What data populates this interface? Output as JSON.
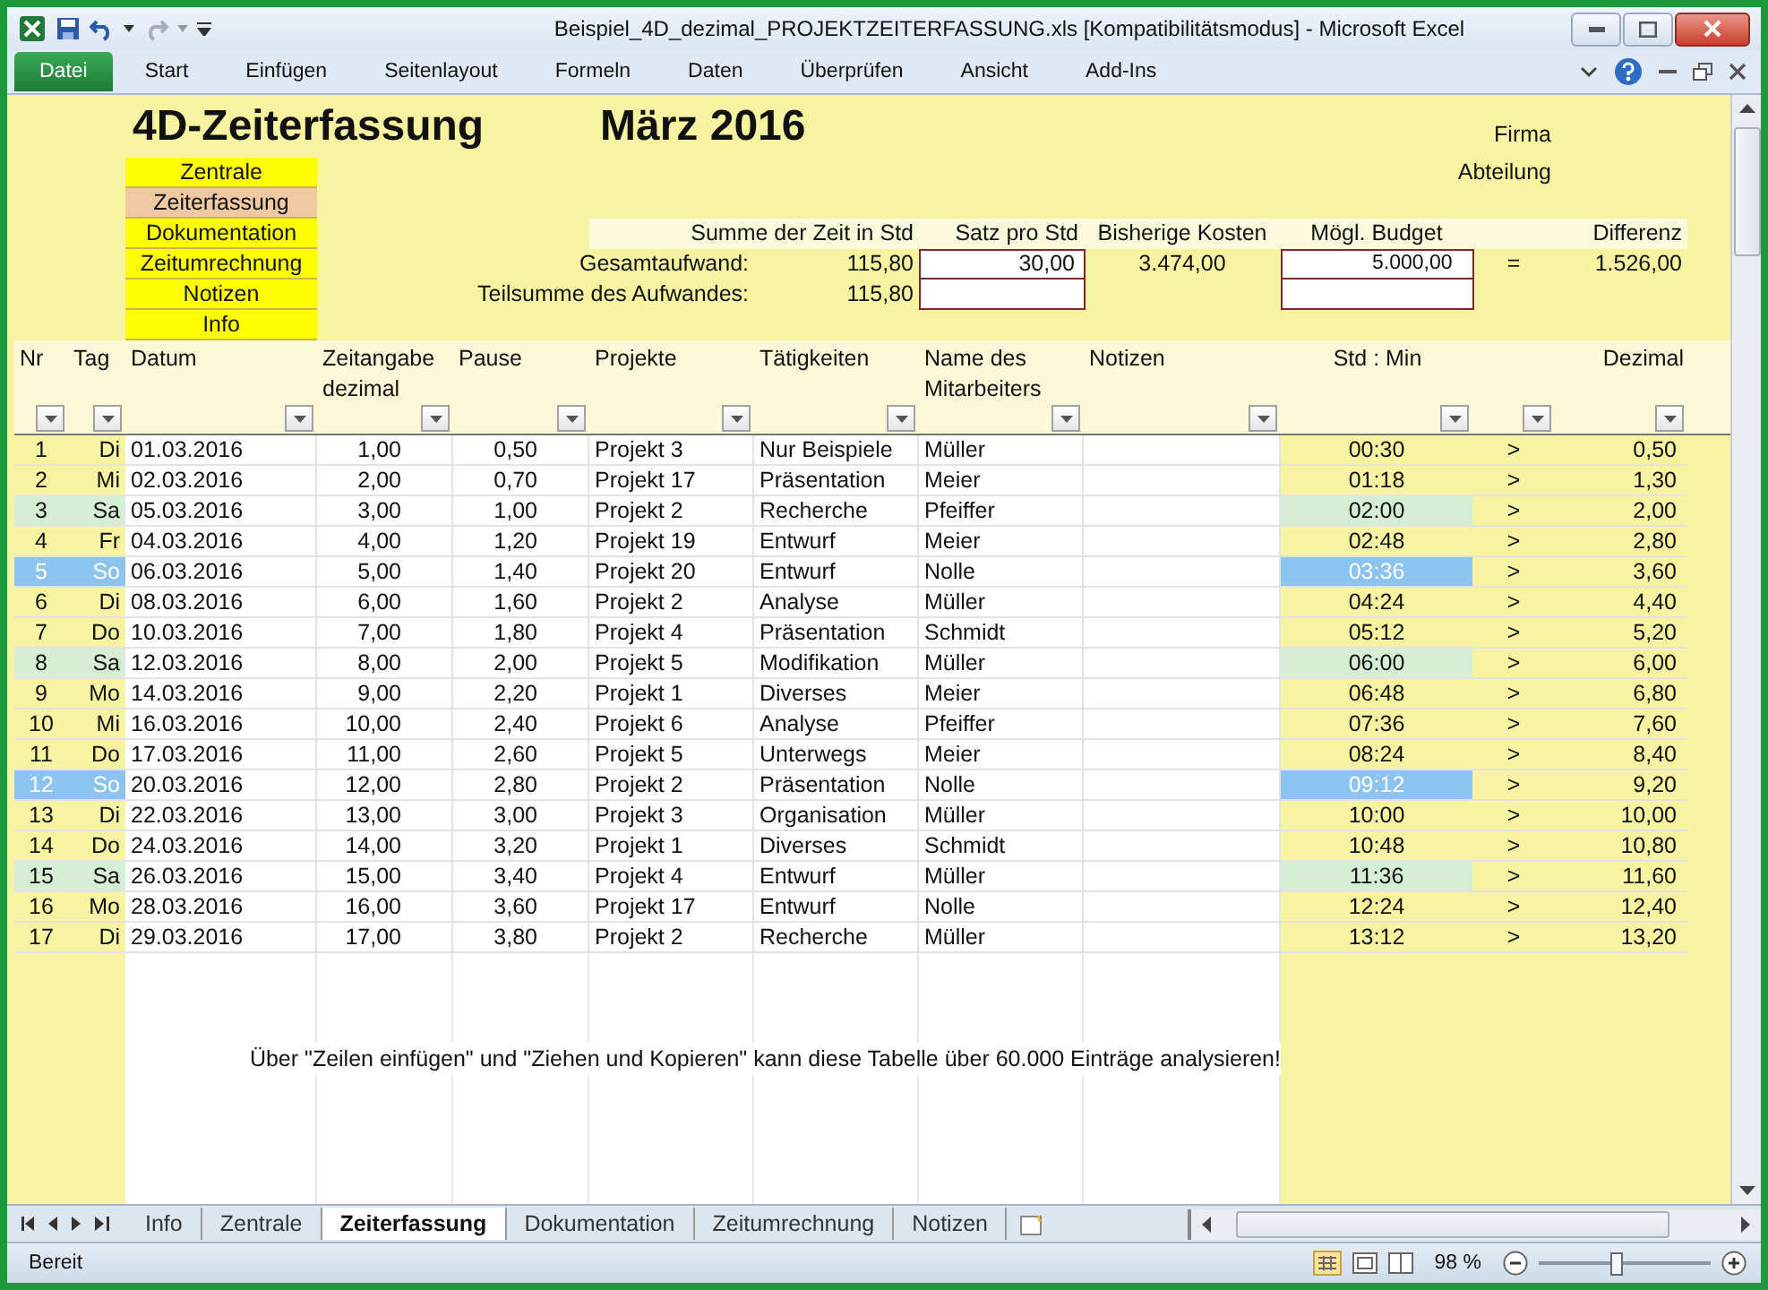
{
  "window": {
    "title": "Beispiel_4D_dezimal_PROJEKTZEITERFASSUNG.xls  [Kompatibilitätsmodus]  -  Microsoft Excel"
  },
  "ribbon": {
    "tabs": [
      {
        "label": "Datei",
        "kind": "file"
      },
      {
        "label": "Start",
        "kind": "tab"
      },
      {
        "label": "Einfügen",
        "kind": "tab"
      },
      {
        "label": "Seitenlayout",
        "kind": "tab"
      },
      {
        "label": "Formeln",
        "kind": "tab"
      },
      {
        "label": "Daten",
        "kind": "tab"
      },
      {
        "label": "Überprüfen",
        "kind": "tab"
      },
      {
        "label": "Ansicht",
        "kind": "tab"
      },
      {
        "label": "Add-Ins",
        "kind": "tab"
      }
    ]
  },
  "sheet": {
    "title": "4D-Zeiterfassung",
    "month": "März 2016",
    "company_label": "Firma",
    "department_label": "Abteilung",
    "nav_buttons": [
      {
        "label": "Zentrale",
        "selected": false
      },
      {
        "label": "Zeiterfassung",
        "selected": true
      },
      {
        "label": "Dokumentation",
        "selected": false
      },
      {
        "label": "Zeitumrechnung",
        "selected": false
      },
      {
        "label": "Notizen",
        "selected": false
      },
      {
        "label": "Info",
        "selected": false
      }
    ],
    "summary": {
      "time_label": "Summe der Zeit in Std",
      "rate_label": "Satz pro Std",
      "costs_label": "Bisherige Kosten",
      "budget_label": "Mögl. Budget",
      "difference_label": "Differenz",
      "rows": [
        {
          "label": "Gesamtaufwand:",
          "time": "115,80",
          "rate": "30,00",
          "costs": "3.474,00",
          "budget": "5.000,00",
          "equals": "=",
          "difference": "1.526,00"
        },
        {
          "label": "Teilsumme des Aufwandes:",
          "time": "115,80"
        }
      ]
    },
    "columns": [
      "Nr",
      "Tag",
      "Datum",
      "Zeitangabe dezimal",
      "Pause",
      "Projekte",
      "Tätigkeiten",
      "Name des Mitarbeiters",
      "Notizen",
      "Std : Min",
      "Dezimal"
    ],
    "rows": [
      {
        "nr": "1",
        "tag": "Di",
        "datum": "01.03.2016",
        "zeit": "1,00",
        "pause": "0,50",
        "projekt": "Projekt 3",
        "taetigkeit": "Nur Beispiele",
        "name": "Müller",
        "std_min": "00:30",
        "arrow": ">",
        "dezimal": "0,50",
        "kind": "weekday"
      },
      {
        "nr": "2",
        "tag": "Mi",
        "datum": "02.03.2016",
        "zeit": "2,00",
        "pause": "0,70",
        "projekt": "Projekt 17",
        "taetigkeit": "Präsentation",
        "name": "Meier",
        "std_min": "01:18",
        "arrow": ">",
        "dezimal": "1,30",
        "kind": "weekday"
      },
      {
        "nr": "3",
        "tag": "Sa",
        "datum": "05.03.2016",
        "zeit": "3,00",
        "pause": "1,00",
        "projekt": "Projekt 2",
        "taetigkeit": "Recherche",
        "name": "Pfeiffer",
        "std_min": "02:00",
        "arrow": ">",
        "dezimal": "2,00",
        "kind": "saturday"
      },
      {
        "nr": "4",
        "tag": "Fr",
        "datum": "04.03.2016",
        "zeit": "4,00",
        "pause": "1,20",
        "projekt": "Projekt 19",
        "taetigkeit": "Entwurf",
        "name": "Meier",
        "std_min": "02:48",
        "arrow": ">",
        "dezimal": "2,80",
        "kind": "weekday"
      },
      {
        "nr": "5",
        "tag": "So",
        "datum": "06.03.2016",
        "zeit": "5,00",
        "pause": "1,40",
        "projekt": "Projekt 20",
        "taetigkeit": "Entwurf",
        "name": "Nolle",
        "std_min": "03:36",
        "arrow": ">",
        "dezimal": "3,60",
        "kind": "sunday"
      },
      {
        "nr": "6",
        "tag": "Di",
        "datum": "08.03.2016",
        "zeit": "6,00",
        "pause": "1,60",
        "projekt": "Projekt 2",
        "taetigkeit": "Analyse",
        "name": "Müller",
        "std_min": "04:24",
        "arrow": ">",
        "dezimal": "4,40",
        "kind": "weekday"
      },
      {
        "nr": "7",
        "tag": "Do",
        "datum": "10.03.2016",
        "zeit": "7,00",
        "pause": "1,80",
        "projekt": "Projekt 4",
        "taetigkeit": "Präsentation",
        "name": "Schmidt",
        "std_min": "05:12",
        "arrow": ">",
        "dezimal": "5,20",
        "kind": "weekday"
      },
      {
        "nr": "8",
        "tag": "Sa",
        "datum": "12.03.2016",
        "zeit": "8,00",
        "pause": "2,00",
        "projekt": "Projekt 5",
        "taetigkeit": "Modifikation",
        "name": "Müller",
        "std_min": "06:00",
        "arrow": ">",
        "dezimal": "6,00",
        "kind": "saturday"
      },
      {
        "nr": "9",
        "tag": "Mo",
        "datum": "14.03.2016",
        "zeit": "9,00",
        "pause": "2,20",
        "projekt": "Projekt 1",
        "taetigkeit": "Diverses",
        "name": "Meier",
        "std_min": "06:48",
        "arrow": ">",
        "dezimal": "6,80",
        "kind": "weekday"
      },
      {
        "nr": "10",
        "tag": "Mi",
        "datum": "16.03.2016",
        "zeit": "10,00",
        "pause": "2,40",
        "projekt": "Projekt 6",
        "taetigkeit": "Analyse",
        "name": "Pfeiffer",
        "std_min": "07:36",
        "arrow": ">",
        "dezimal": "7,60",
        "kind": "weekday"
      },
      {
        "nr": "11",
        "tag": "Do",
        "datum": "17.03.2016",
        "zeit": "11,00",
        "pause": "2,60",
        "projekt": "Projekt 5",
        "taetigkeit": "Unterwegs",
        "name": "Meier",
        "std_min": "08:24",
        "arrow": ">",
        "dezimal": "8,40",
        "kind": "weekday"
      },
      {
        "nr": "12",
        "tag": "So",
        "datum": "20.03.2016",
        "zeit": "12,00",
        "pause": "2,80",
        "projekt": "Projekt 2",
        "taetigkeit": "Präsentation",
        "name": "Nolle",
        "std_min": "09:12",
        "arrow": ">",
        "dezimal": "9,20",
        "kind": "sunday"
      },
      {
        "nr": "13",
        "tag": "Di",
        "datum": "22.03.2016",
        "zeit": "13,00",
        "pause": "3,00",
        "projekt": "Projekt 3",
        "taetigkeit": "Organisation",
        "name": "Müller",
        "std_min": "10:00",
        "arrow": ">",
        "dezimal": "10,00",
        "kind": "weekday"
      },
      {
        "nr": "14",
        "tag": "Do",
        "datum": "24.03.2016",
        "zeit": "14,00",
        "pause": "3,20",
        "projekt": "Projekt 1",
        "taetigkeit": "Diverses",
        "name": "Schmidt",
        "std_min": "10:48",
        "arrow": ">",
        "dezimal": "10,80",
        "kind": "weekday"
      },
      {
        "nr": "15",
        "tag": "Sa",
        "datum": "26.03.2016",
        "zeit": "15,00",
        "pause": "3,40",
        "projekt": "Projekt 4",
        "taetigkeit": "Entwurf",
        "name": "Müller",
        "std_min": "11:36",
        "arrow": ">",
        "dezimal": "11,60",
        "kind": "saturday"
      },
      {
        "nr": "16",
        "tag": "Mo",
        "datum": "28.03.2016",
        "zeit": "16,00",
        "pause": "3,60",
        "projekt": "Projekt 17",
        "taetigkeit": "Entwurf",
        "name": "Nolle",
        "std_min": "12:24",
        "arrow": ">",
        "dezimal": "12,40",
        "kind": "weekday"
      },
      {
        "nr": "17",
        "tag": "Di",
        "datum": "29.03.2016",
        "zeit": "17,00",
        "pause": "3,80",
        "projekt": "Projekt 2",
        "taetigkeit": "Recherche",
        "name": "Müller",
        "std_min": "13:12",
        "arrow": ">",
        "dezimal": "13,20",
        "kind": "weekday"
      }
    ],
    "note": "Über \"Zeilen einfügen\" und \"Ziehen und Kopieren\" kann diese Tabelle über 60.000 Einträge analysieren!"
  },
  "sheet_tabs": [
    {
      "label": "Info",
      "selected": false
    },
    {
      "label": "Zentrale",
      "selected": false
    },
    {
      "label": "Zeiterfassung",
      "selected": true
    },
    {
      "label": "Dokumentation",
      "selected": false
    },
    {
      "label": "Zeitumrechnung",
      "selected": false
    },
    {
      "label": "Notizen",
      "selected": false
    }
  ],
  "status_bar": {
    "status": "Bereit",
    "zoom": {
      "label": "98 %",
      "level": 0.45
    }
  }
}
